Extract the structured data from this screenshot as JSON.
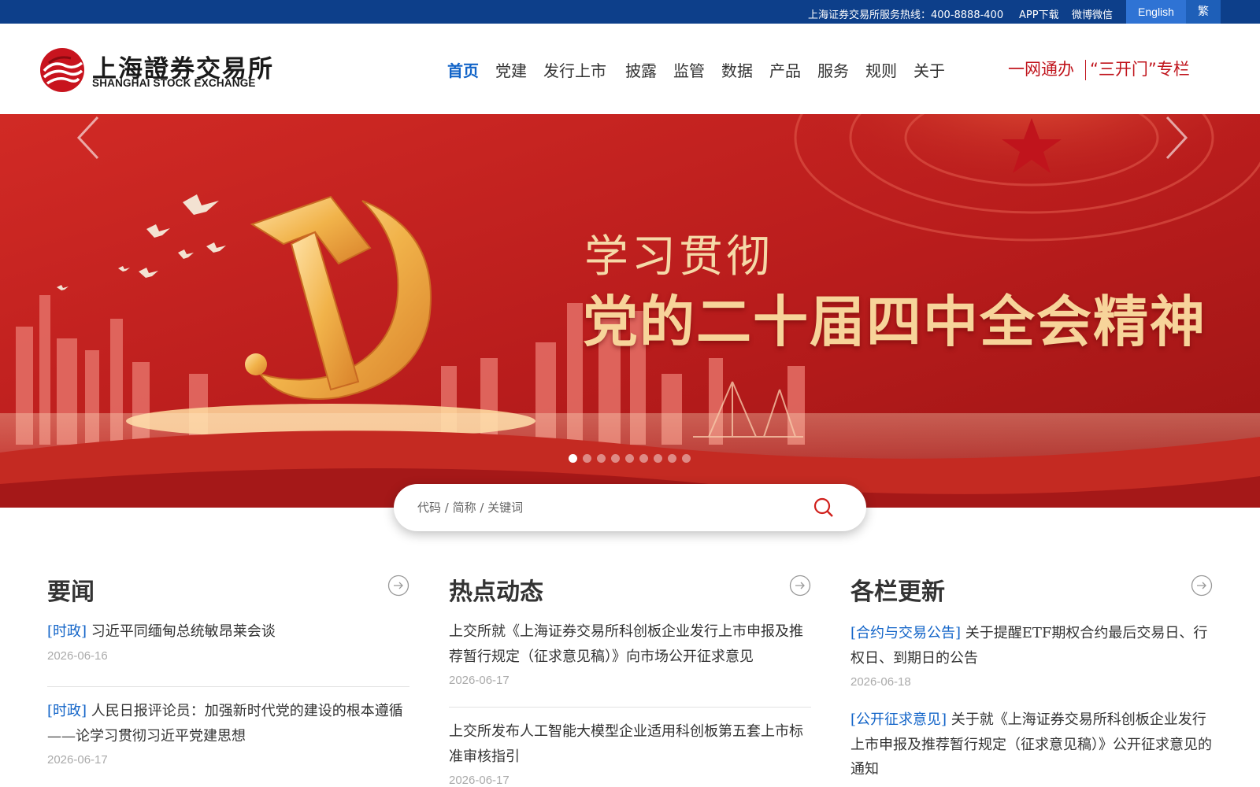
{
  "topbar": {
    "hotline": "上海证券交易所服务热线：400-8888-400",
    "app": "APP下载",
    "social": "微博微信",
    "lang_en": "English",
    "lang_tc": "繁"
  },
  "logo": {
    "cn": "上海證券交易所",
    "en": "SHANGHAI STOCK EXCHANGE"
  },
  "nav": {
    "items": [
      "首页",
      "党建",
      "发行上市",
      "披露",
      "监管",
      "数据",
      "产品",
      "服务",
      "规则",
      "关于"
    ],
    "active_index": 0
  },
  "special": {
    "left": "一网通办",
    "right": "“三开门”专栏"
  },
  "banner": {
    "line1": "学习贯彻",
    "line2": "党的二十届四中全会精神",
    "slide_count": 9,
    "active_slide": 1
  },
  "search": {
    "placeholder": "代码 / 简称 / 关键词"
  },
  "columns": {
    "news": {
      "title": "要闻",
      "items": [
        {
          "tag": "[时政]",
          "text": " 习近平同缅甸总统敏昂莱会谈",
          "date": "2026-06-16"
        },
        {
          "tag": "[时政]",
          "text": " 人民日报评论员：加强新时代党的建设的根本遵循——论学习贯彻习近平党建思想",
          "date": "2026-06-17"
        }
      ]
    },
    "hot": {
      "title": "热点动态",
      "items": [
        {
          "tag": "",
          "text": "上交所就《上海证券交易所科创板企业发行上市申报及推荐暂行规定（征求意见稿）》向市场公开征求意见",
          "date": "2026-06-17"
        },
        {
          "tag": "",
          "text": "上交所发布人工智能大模型企业适用科创板第五套上市标准审核指引",
          "date": "2026-06-17"
        }
      ]
    },
    "updates": {
      "title": "各栏更新",
      "items": [
        {
          "tag": "[合约与交易公告]",
          "text": " 关于提醒ETF期权合约最后交易日、行权日、到期日的公告",
          "date": "2026-06-18"
        },
        {
          "tag": "[公开征求意见]",
          "text": " 关于就《上海证券交易所科创板企业发行上市申报及推荐暂行规定（征求意见稿）》公开征求意见的通知",
          "date": ""
        }
      ]
    }
  },
  "colors": {
    "topbar": "#0d3f8a",
    "nav_active": "#1264c8",
    "special": "#c0141c",
    "banner_red": "#b81c1c",
    "banner_gold": "#f7d49a"
  }
}
